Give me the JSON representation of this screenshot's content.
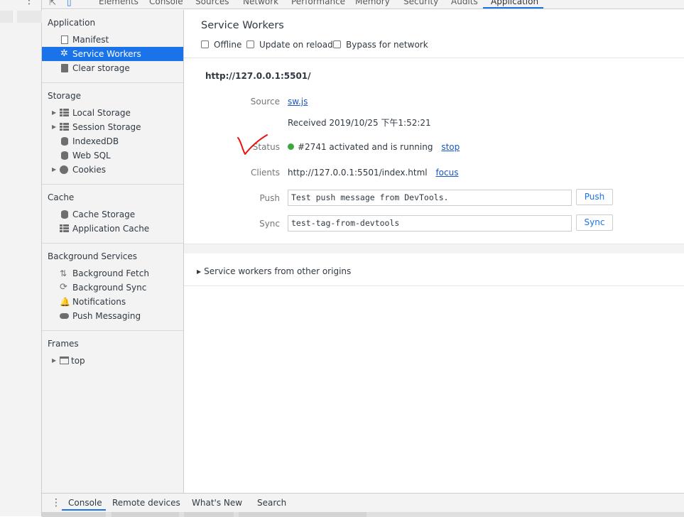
{
  "top_tabs": [
    "Elements",
    "Console",
    "Sources",
    "Network",
    "Performance",
    "Memory",
    "Security",
    "Audits",
    "Application"
  ],
  "sidebar": {
    "sections": [
      {
        "title": "Application",
        "items": [
          {
            "label": "Manifest",
            "icon": "document-icon"
          },
          {
            "label": "Service Workers",
            "icon": "gear-icon",
            "selected": true
          },
          {
            "label": "Clear storage",
            "icon": "trash-icon"
          }
        ]
      },
      {
        "title": "Storage",
        "items": [
          {
            "label": "Local Storage",
            "icon": "table-icon",
            "expandable": true
          },
          {
            "label": "Session Storage",
            "icon": "table-icon",
            "expandable": true
          },
          {
            "label": "IndexedDB",
            "icon": "database-icon"
          },
          {
            "label": "Web SQL",
            "icon": "database-icon"
          },
          {
            "label": "Cookies",
            "icon": "cookie-icon",
            "expandable": true
          }
        ]
      },
      {
        "title": "Cache",
        "items": [
          {
            "label": "Cache Storage",
            "icon": "database-icon"
          },
          {
            "label": "Application Cache",
            "icon": "table-icon"
          }
        ]
      },
      {
        "title": "Background Services",
        "items": [
          {
            "label": "Background Fetch",
            "icon": "up-down-arrows-icon"
          },
          {
            "label": "Background Sync",
            "icon": "sync-icon"
          },
          {
            "label": "Notifications",
            "icon": "bell-icon"
          },
          {
            "label": "Push Messaging",
            "icon": "cloud-icon"
          }
        ]
      },
      {
        "title": "Frames",
        "items": [
          {
            "label": "top",
            "icon": "frame-icon",
            "expandable": true
          }
        ]
      }
    ]
  },
  "main": {
    "title": "Service Workers",
    "options": [
      {
        "label": "Offline",
        "checked": false
      },
      {
        "label": "Update on reload",
        "checked": false
      },
      {
        "label": "Bypass for network",
        "checked": false
      }
    ],
    "origin": "http://127.0.0.1:5501/",
    "source_label": "Source",
    "source_link": "sw.js",
    "received": "Received 2019/10/25 下午1:52:21",
    "status_label": "Status",
    "status_text": "#2741 activated and is running",
    "status_color": "#3fa63f",
    "status_action": "stop",
    "clients_label": "Clients",
    "clients_url": "http://127.0.0.1:5501/index.html",
    "clients_action": "focus",
    "push_label": "Push",
    "push_value": "Test push message from DevTools.",
    "push_button": "Push",
    "sync_label": "Sync",
    "sync_value": "test-tag-from-devtools",
    "sync_button": "Sync",
    "other_origins": "Service workers from other origins"
  },
  "drawer_tabs": [
    "Console",
    "Remote devices",
    "What's New",
    "Search"
  ],
  "accent_color": "#1a73e8"
}
